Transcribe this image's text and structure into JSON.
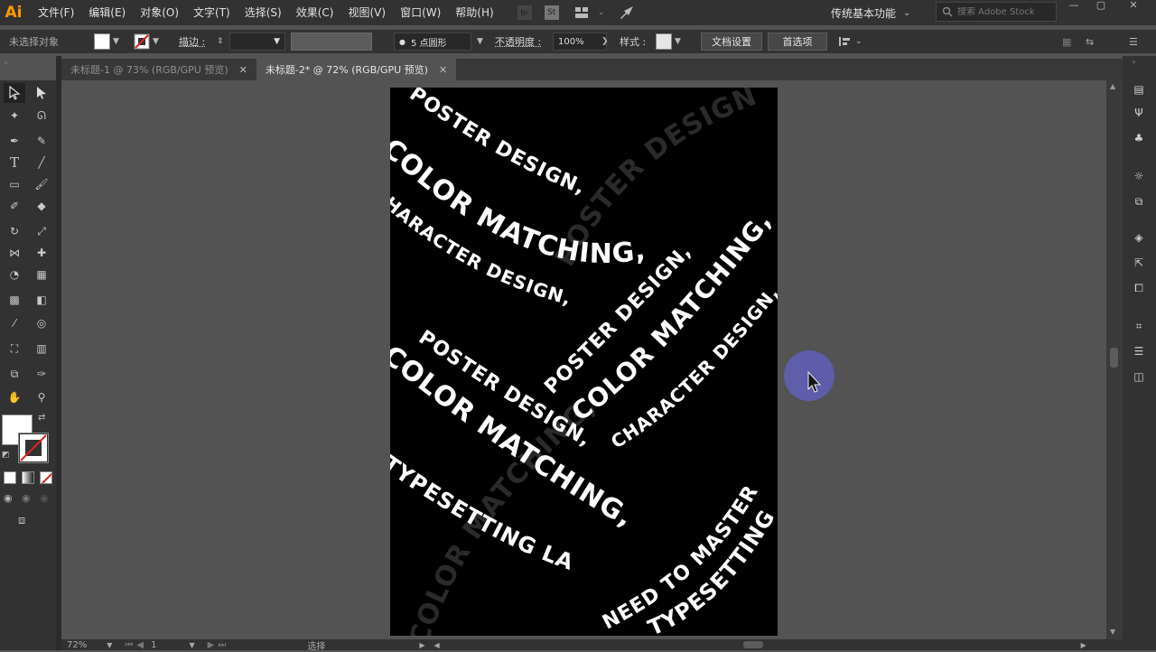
{
  "app": {
    "logo": "Ai"
  },
  "menu": [
    "文件(F)",
    "编辑(E)",
    "对象(O)",
    "文字(T)",
    "选择(S)",
    "效果(C)",
    "视图(V)",
    "窗口(W)",
    "帮助(H)"
  ],
  "menubar_icons": {
    "bridge": "Br",
    "stock": "St"
  },
  "workspace": {
    "label": "传统基本功能"
  },
  "stock_search": {
    "placeholder": "搜索 Adobe Stock"
  },
  "control_bar": {
    "selection_status": "未选择对象",
    "stroke_label": "描边 :",
    "brush_value": "5 点圆形",
    "opacity_label": "不透明度 :",
    "opacity_value": "100%",
    "style_label": "样式 :",
    "doc_setup_button": "文档设置",
    "preferences_button": "首选项"
  },
  "tabs": [
    {
      "label": "未标题-1 @ 73% (RGB/GPU 预览)",
      "active": false
    },
    {
      "label": "未标题-2* @ 72% (RGB/GPU 预览)",
      "active": true
    }
  ],
  "status": {
    "zoom": "72%",
    "page": "1",
    "tool": "选择"
  },
  "artwork": {
    "background": "#000000",
    "words": [
      "POSTER DESIGN,",
      "COLOR MATCHING,",
      "NEED TO MASTER",
      "TYPESETTING LA",
      "CHARACTER DESIGN,",
      "DESIGN"
    ]
  },
  "colors": {
    "accent": "#ff9a00",
    "cursor_ring": "#5f5fb4"
  }
}
